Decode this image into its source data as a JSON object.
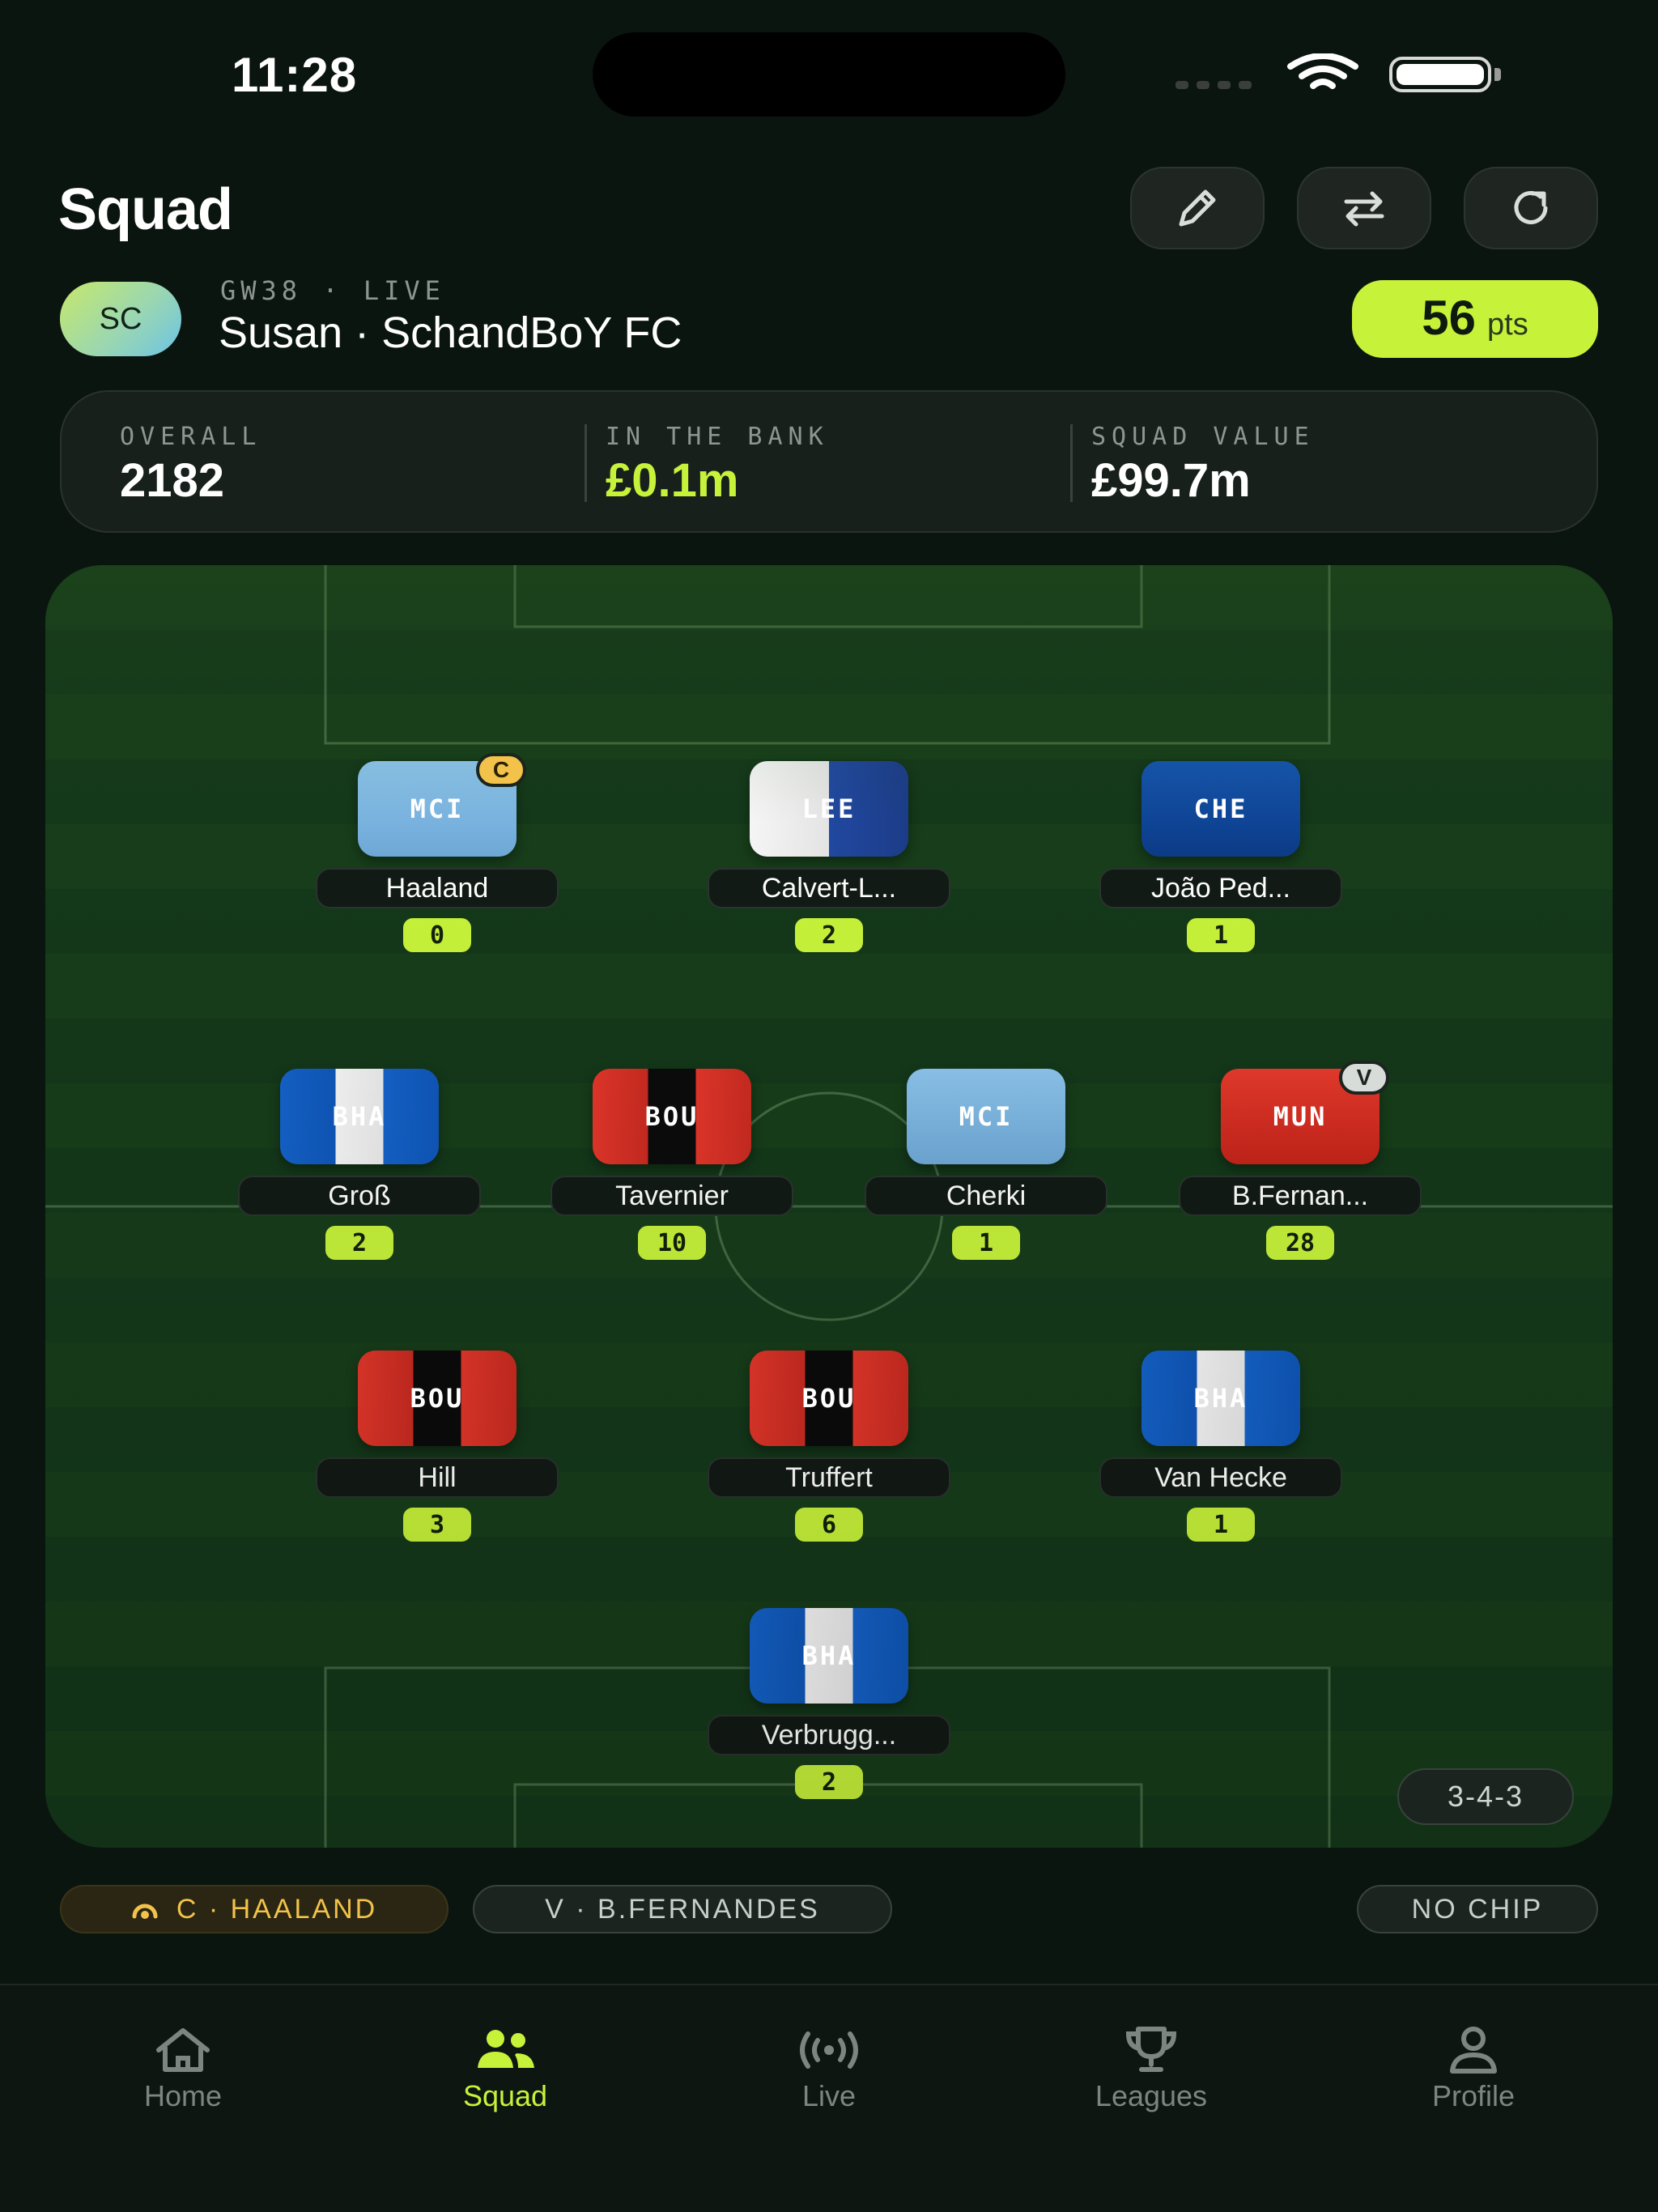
{
  "status": {
    "time": "11:28"
  },
  "header": {
    "title": "Squad"
  },
  "team": {
    "avatar": "SC",
    "gameweek": "GW38 · LIVE",
    "name": "Susan · SchandBoY FC",
    "points": "56",
    "points_unit": "pts"
  },
  "stats": {
    "overall_label": "OVERALL",
    "overall_value": "2182",
    "bank_label": "IN THE BANK",
    "bank_value": "£0.1m",
    "value_label": "SQUAD VALUE",
    "value_value": "£99.7m"
  },
  "players": {
    "haaland": {
      "team": "MCI",
      "name": "Haaland",
      "points": "0",
      "armband": "C"
    },
    "calvert": {
      "team": "LEE",
      "name": "Calvert-L...",
      "points": "2"
    },
    "joao": {
      "team": "CHE",
      "name": "João Ped...",
      "points": "1"
    },
    "gross": {
      "team": "BHA",
      "name": "Groß",
      "points": "2"
    },
    "tavernier": {
      "team": "BOU",
      "name": "Tavernier",
      "points": "10"
    },
    "cherki": {
      "team": "MCI",
      "name": "Cherki",
      "points": "1"
    },
    "fernandes": {
      "team": "MUN",
      "name": "B.Fernan...",
      "points": "28",
      "armband": "V"
    },
    "hill": {
      "team": "BOU",
      "name": "Hill",
      "points": "3"
    },
    "truffert": {
      "team": "BOU",
      "name": "Truffert",
      "points": "6"
    },
    "vanhecke": {
      "team": "BHA",
      "name": "Van Hecke",
      "points": "1"
    },
    "verbruggen": {
      "team": "BHA",
      "name": "Verbrugg...",
      "points": "2"
    }
  },
  "formation": "3-4-3",
  "chips": {
    "captain": "C · HAALAND",
    "vice": "V · B.FERNANDES",
    "chip": "NO CHIP"
  },
  "tabs": {
    "home": "Home",
    "squad": "Squad",
    "live": "Live",
    "leagues": "Leagues",
    "profile": "Profile"
  },
  "colors": {
    "accent": "#c6f23a",
    "captain": "#f2c24a",
    "background": "#0b1510"
  }
}
